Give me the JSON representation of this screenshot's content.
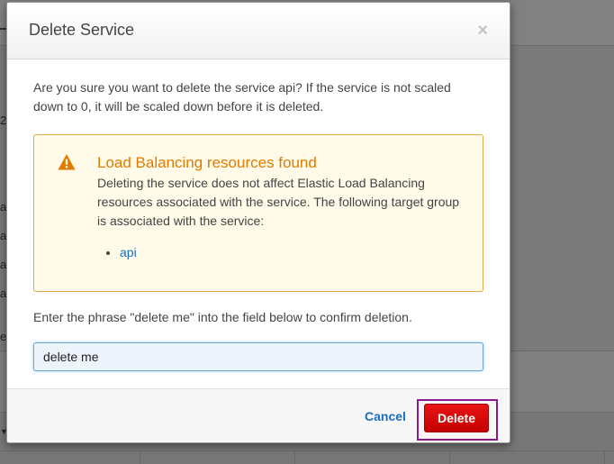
{
  "background": {
    "fragments": [
      "2",
      "a",
      "a",
      "a",
      "a",
      "e"
    ]
  },
  "dialog": {
    "title": "Delete Service",
    "close_glyph": "×",
    "confirm_text": "Are you sure you want to delete the service api? If the service is not scaled down to 0, it will be scaled down before it is deleted.",
    "alert": {
      "icon": "warning-icon",
      "title": "Load Balancing resources found",
      "text": "Deleting the service does not affect Elastic Load Balancing resources associated with the service. The following target group is associated with the service:",
      "target_groups": [
        "api"
      ]
    },
    "phrase_prompt": "Enter the phrase \"delete me\" into the field below to confirm deletion.",
    "phrase_input_value": "delete me",
    "cancel_label": "Cancel",
    "delete_label": "Delete"
  },
  "colors": {
    "alert_title": "#e07b00",
    "link": "#1a6fbd",
    "delete_button": "#d40000",
    "highlight_border": "#8d1a8d"
  }
}
